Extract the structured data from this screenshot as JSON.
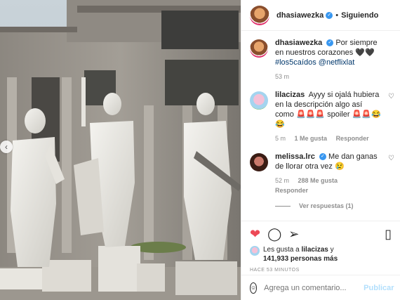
{
  "header": {
    "username": "dhasiawezka",
    "separator": "•",
    "follow_status": "Siguiendo"
  },
  "caption": {
    "username": "dhasiawezka",
    "text": "Por siempre en nuestros corazones 🖤🖤",
    "hashtag": "#los5caídos",
    "mention": "@netflixlat",
    "time": "53 m"
  },
  "comments": [
    {
      "username": "lilacizas",
      "text": "Ayyy si ojalá hubiera en la descripción algo así como 🚨🚨🚨 spoiler 🚨🚨😂😂",
      "time": "5 m",
      "likes": "1 Me gusta",
      "reply": "Responder"
    },
    {
      "username": "melissa.lrc",
      "text": "Me dan ganas de llorar otra vez 😢",
      "time": "52 m",
      "likes": "288 Me gusta",
      "reply": "Responder",
      "view_replies": "Ver respuestas (1)"
    }
  ],
  "likes_summary": {
    "prefix": "Les gusta a",
    "first_user": "lilacizas",
    "conj": "y",
    "count_text": "141,933 personas más"
  },
  "timestamp": "HACE 53 MINUTOS",
  "add_comment": {
    "placeholder": "Agrega un comentario...",
    "publish": "Publicar"
  },
  "colors": {
    "like_red": "#ed4956",
    "link_blue": "#00376b",
    "verified_blue": "#3897f0"
  }
}
